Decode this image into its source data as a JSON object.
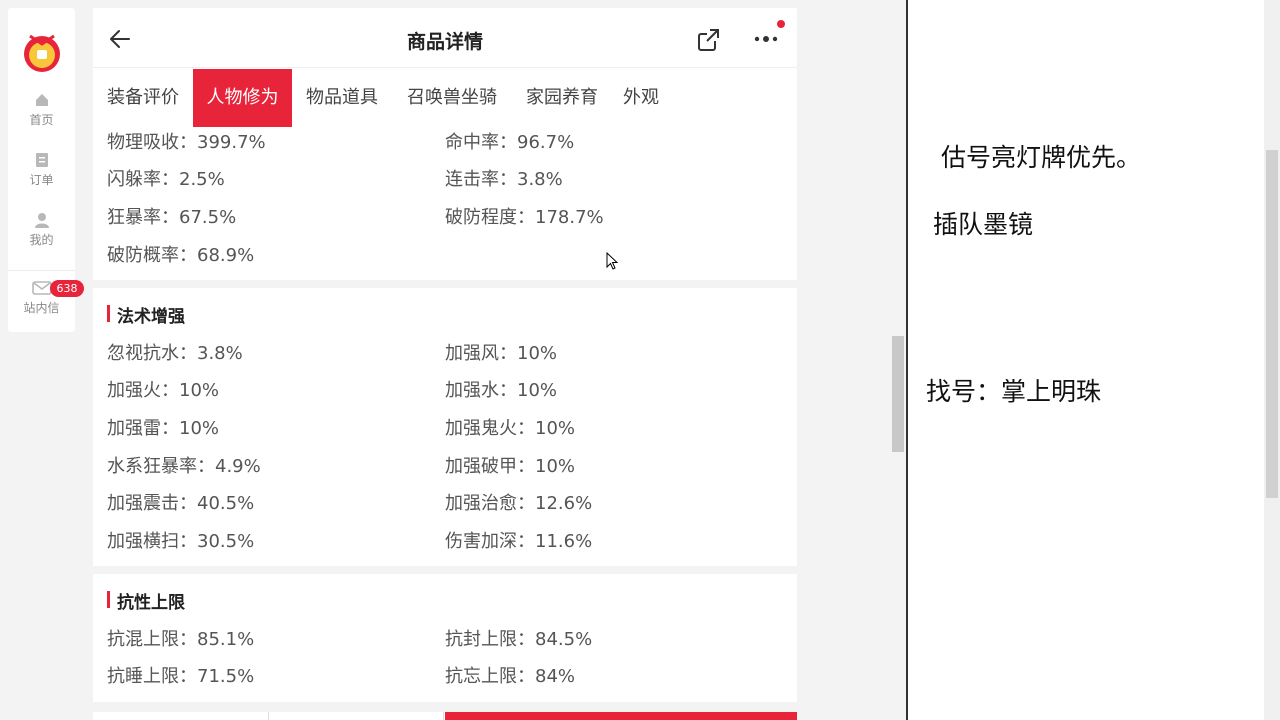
{
  "leftnav": {
    "items": [
      {
        "label": "首页",
        "icon": "home-icon"
      },
      {
        "label": "订单",
        "icon": "order-icon"
      },
      {
        "label": "我的",
        "icon": "user-icon"
      },
      {
        "label": "站内信",
        "icon": "mail-icon"
      }
    ],
    "badge": "638"
  },
  "header": {
    "title": "商品详情"
  },
  "tabs": [
    {
      "label": "装备评价"
    },
    {
      "label": "人物修为"
    },
    {
      "label": "物品道具"
    },
    {
      "label": "召唤兽坐骑"
    },
    {
      "label": "家园养育"
    },
    {
      "label": "外观"
    }
  ],
  "stats_top": [
    {
      "key": "物理吸收：",
      "value": "399.7%"
    },
    {
      "key": "命中率：",
      "value": "96.7%"
    },
    {
      "key": "闪躲率：",
      "value": "2.5%"
    },
    {
      "key": "连击率：",
      "value": "3.8%"
    },
    {
      "key": "狂暴率：",
      "value": "67.5%"
    },
    {
      "key": "破防程度：",
      "value": "178.7%"
    },
    {
      "key": "破防概率：",
      "value": "68.9%"
    }
  ],
  "section_magic": {
    "title": "法术增强",
    "items": [
      {
        "key": "忽视抗水：",
        "value": "3.8%"
      },
      {
        "key": "加强风：",
        "value": "10%"
      },
      {
        "key": "加强火：",
        "value": "10%"
      },
      {
        "key": "加强水：",
        "value": "10%"
      },
      {
        "key": "加强雷：",
        "value": "10%"
      },
      {
        "key": "加强鬼火：",
        "value": "10%"
      },
      {
        "key": "水系狂暴率：",
        "value": "4.9%"
      },
      {
        "key": "加强破甲：",
        "value": "10%"
      },
      {
        "key": "加强震击：",
        "value": "40.5%"
      },
      {
        "key": "加强治愈：",
        "value": "12.6%"
      },
      {
        "key": "加强横扫：",
        "value": "30.5%"
      },
      {
        "key": "伤害加深：",
        "value": "11.6%"
      }
    ]
  },
  "section_resist": {
    "title": "抗性上限",
    "items": [
      {
        "key": "抗混上限：",
        "value": "85.1%"
      },
      {
        "key": "抗封上限：",
        "value": "84.5%"
      },
      {
        "key": "抗睡上限：",
        "value": "71.5%"
      },
      {
        "key": "抗忘上限：",
        "value": "84%"
      }
    ]
  },
  "notes": {
    "line1": "估号亮灯牌优先。",
    "line2": "插队墨镜",
    "line3": "找号：掌上明珠"
  },
  "colors": {
    "accent": "#e8243b"
  }
}
